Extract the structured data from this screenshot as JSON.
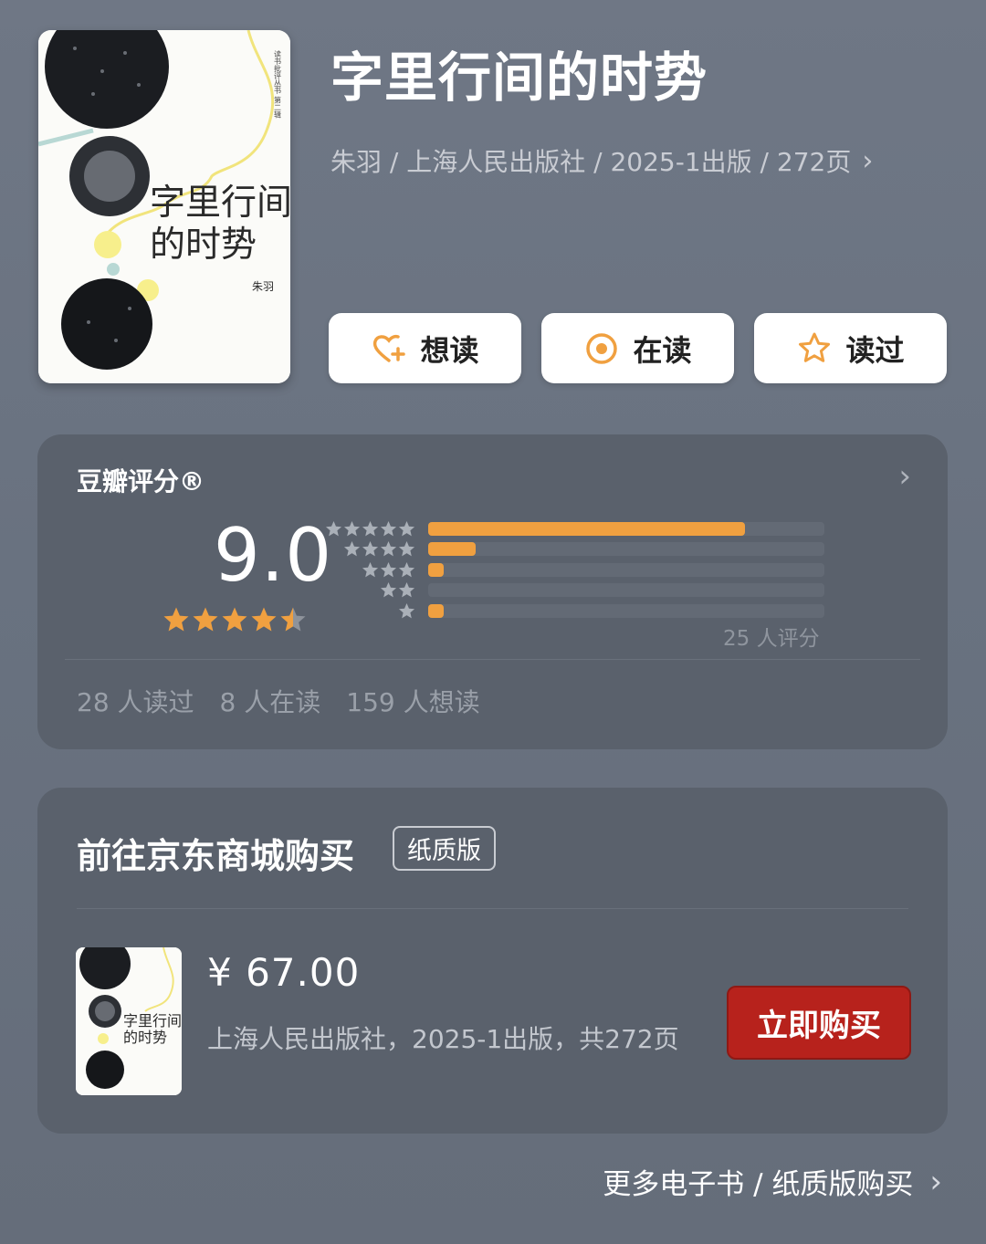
{
  "book": {
    "title": "字里行间的时势",
    "meta": "朱羽 / 上海人民出版社 / 2025-1出版 / 272页",
    "cover": {
      "title_line1": "字里行间",
      "title_line2": "的时势",
      "author": "朱羽",
      "series": "读书批评丛书 第二辑"
    }
  },
  "actions": [
    {
      "label": "想读",
      "icon": "heart-plus-icon"
    },
    {
      "label": "在读",
      "icon": "target-icon"
    },
    {
      "label": "读过",
      "icon": "star-outline-icon"
    }
  ],
  "rating": {
    "header": "豆瓣评分®",
    "score": "9.0",
    "stars": 4.5,
    "distribution": [
      {
        "stars": 5,
        "fraction": 0.8
      },
      {
        "stars": 4,
        "fraction": 0.12
      },
      {
        "stars": 3,
        "fraction": 0.04
      },
      {
        "stars": 2,
        "fraction": 0.0
      },
      {
        "stars": 1,
        "fraction": 0.04
      }
    ],
    "count_label": "25 人评分",
    "stats": [
      "28 人读过",
      "8 人在读",
      "159 人想读"
    ]
  },
  "purchase": {
    "store": "前往京东商城购买",
    "edition": "纸质版",
    "price": "¥ 67.00",
    "publisher_info": "上海人民出版社，2025-1出版，共272页",
    "buy_label": "立即购买"
  },
  "more_link": "更多电子书 / 纸质版购买",
  "colors": {
    "accent": "#f0a040",
    "buy_button": "#b7221c",
    "card_bg": "#5a616c"
  }
}
